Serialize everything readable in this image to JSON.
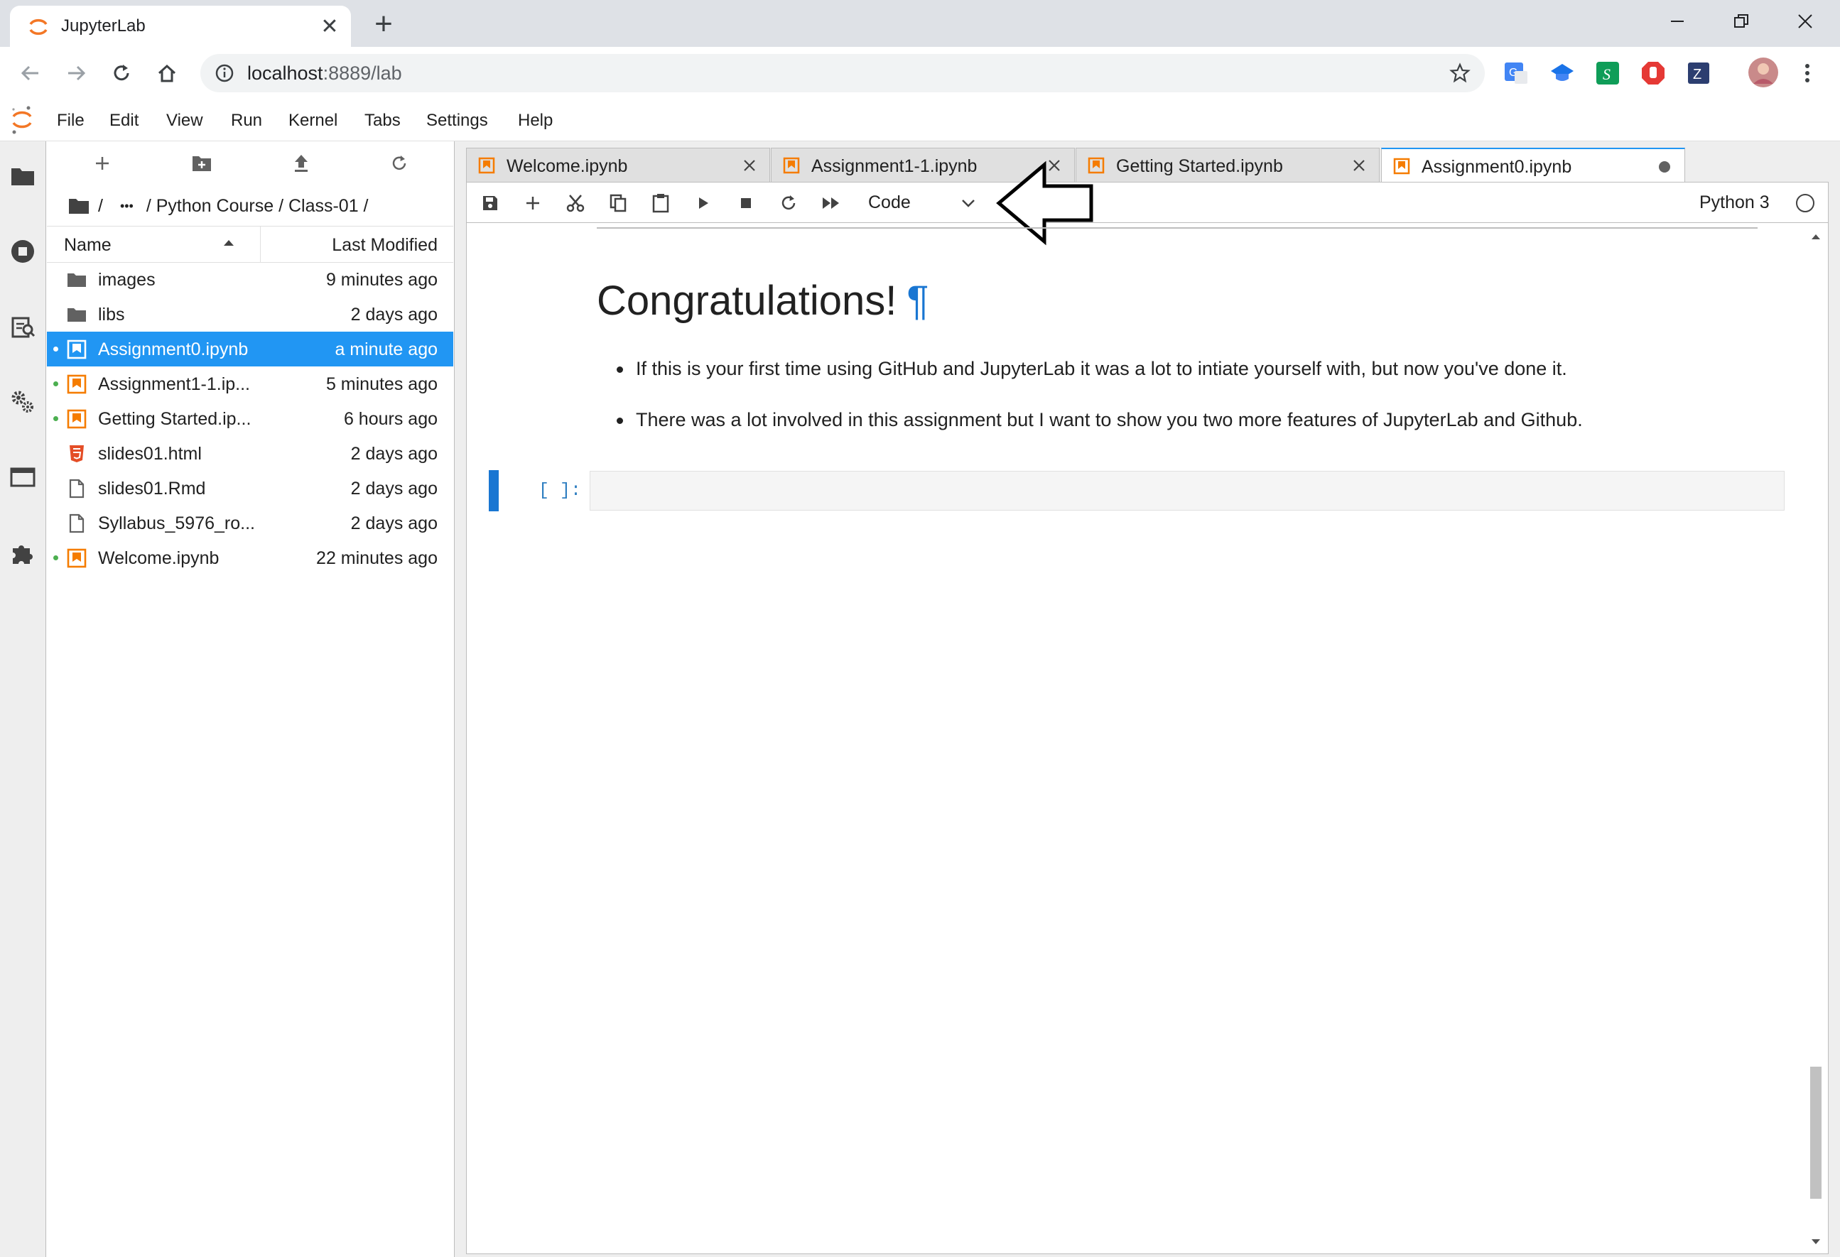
{
  "browser": {
    "tab_title": "JupyterLab",
    "new_tab_symbol": "+",
    "close_symbol": "✕",
    "url_host": "localhost",
    "url_rest": ":8889/lab"
  },
  "menubar": {
    "items": [
      "File",
      "Edit",
      "View",
      "Run",
      "Kernel",
      "Tabs",
      "Settings",
      "Help"
    ]
  },
  "filebrowser": {
    "breadcrumb": [
      "/",
      "•••",
      "/ Python Course / Class-01 /"
    ],
    "header_name": "Name",
    "header_modified": "Last Modified",
    "files": [
      {
        "name": "images",
        "modified": "9 minutes ago",
        "icon": "folder-icon",
        "running": false,
        "selected": false
      },
      {
        "name": "libs",
        "modified": "2 days ago",
        "icon": "folder-icon",
        "running": false,
        "selected": false
      },
      {
        "name": "Assignment0.ipynb",
        "modified": "a minute ago",
        "icon": "notebook-icon",
        "running": true,
        "selected": true
      },
      {
        "name": "Assignment1-1.ip...",
        "modified": "5 minutes ago",
        "icon": "notebook-icon",
        "running": true,
        "selected": false
      },
      {
        "name": "Getting Started.ip...",
        "modified": "6 hours ago",
        "icon": "notebook-icon",
        "running": true,
        "selected": false
      },
      {
        "name": "slides01.html",
        "modified": "2 days ago",
        "icon": "html5-icon",
        "running": false,
        "selected": false
      },
      {
        "name": "slides01.Rmd",
        "modified": "2 days ago",
        "icon": "file-icon",
        "running": false,
        "selected": false
      },
      {
        "name": "Syllabus_5976_ro...",
        "modified": "2 days ago",
        "icon": "file-icon",
        "running": false,
        "selected": false
      },
      {
        "name": "Welcome.ipynb",
        "modified": "22 minutes ago",
        "icon": "notebook-icon",
        "running": true,
        "selected": false
      }
    ]
  },
  "doc_tabs": [
    {
      "label": "Welcome.ipynb",
      "active": false
    },
    {
      "label": "Assignment1-1.ipynb",
      "active": false
    },
    {
      "label": "Getting Started.ipynb",
      "active": false
    },
    {
      "label": "Assignment0.ipynb",
      "active": true
    }
  ],
  "notebook": {
    "cell_type": "Code",
    "kernel": "Python 3",
    "heading": "Congratulations!",
    "anchor": "¶",
    "bullets": [
      "If this is your first time using GitHub and JupyterLab it was a lot to intiate yourself with, but now you've done it.",
      "There was a lot involved in this assignment but I want to show you two more features of JupyterLab and Github."
    ],
    "prompt": "[ ]:"
  },
  "colors": {
    "accent": "#2196f3",
    "notebook_orange": "#f57c00",
    "running_green": "#4caf50",
    "jupyter_orange": "#f37726",
    "anchor_blue": "#1976d2"
  }
}
